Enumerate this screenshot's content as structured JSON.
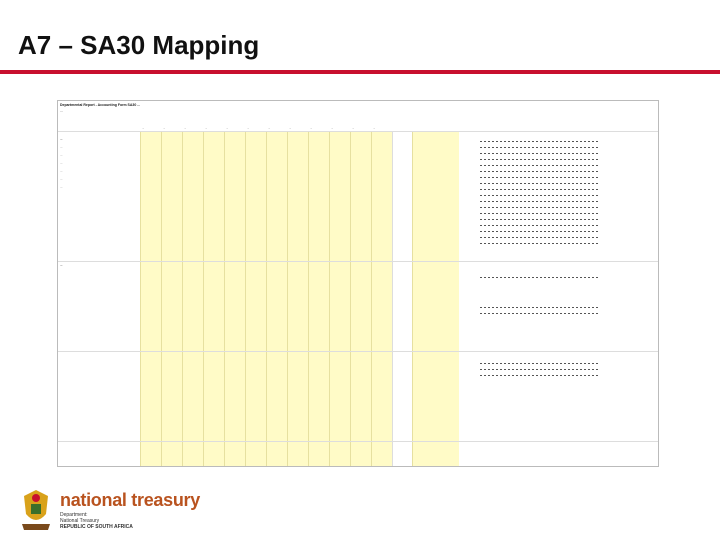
{
  "slide": {
    "title": "A7 – SA30 Mapping"
  },
  "sheet": {
    "heading": "Departmental Report - Accounting Form SA30 ...",
    "subheading": "...",
    "months": [
      "...",
      "...",
      "...",
      "...",
      "...",
      "...",
      "...",
      "...",
      "...",
      "...",
      "...",
      "..."
    ],
    "rows": [
      {
        "label": "...",
        "bold": true
      },
      {
        "label": "...",
        "bold": true
      },
      {
        "label": "...",
        "bold": false
      },
      {
        "label": "...",
        "bold": false
      },
      {
        "label": "...",
        "bold": false
      },
      {
        "label": "...",
        "bold": false
      },
      {
        "label": "...",
        "bold": false
      },
      {
        "label": "...",
        "bold": false
      }
    ]
  },
  "footer": {
    "brand": "national treasury",
    "sub1": "Department:",
    "sub2": "National Treasury",
    "sub3": "REPUBLIC OF SOUTH AFRICA"
  }
}
